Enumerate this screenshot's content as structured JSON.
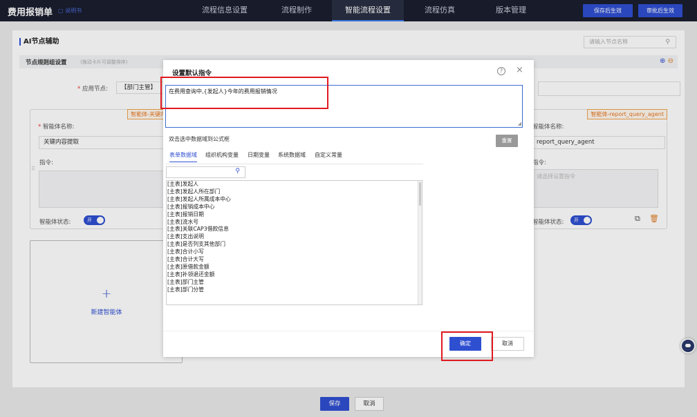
{
  "app": {
    "title": "费用报销单",
    "doc_link": "说明书"
  },
  "nav": {
    "tabs": [
      {
        "label": "流程信息设置"
      },
      {
        "label": "流程制作"
      },
      {
        "label": "智能流程设置"
      },
      {
        "label": "流程仿真"
      },
      {
        "label": "版本管理"
      }
    ],
    "active_index": 2,
    "save_label": "保存后生效",
    "approve_label": "审批后生效"
  },
  "page": {
    "section_title": "AI节点辅助",
    "search_placeholder": "请输入节点名称",
    "group_title": "节点规则组设置",
    "group_hint": "(拖动卡片可调整排序)",
    "apply_node_label": "应用节点:",
    "apply_node_value": "【部门主管】"
  },
  "left_card": {
    "tag": "智能体-关键内容",
    "name_label": "智能体名称:",
    "name_value": "关键内容提取",
    "instruction_label": "指令:",
    "status_label": "智能体状态:",
    "toggle_label": "开"
  },
  "right_card": {
    "tag": "智能体-report_query_agent",
    "name_label": "智能体名称:",
    "name_value": "report_query_agent",
    "instruction_label": "指令:",
    "instruction_placeholder": "请选择设置指令",
    "status_label": "智能体状态:",
    "toggle_label": "开"
  },
  "new_agent": {
    "plus": "+",
    "label": "新建智能体"
  },
  "bottom": {
    "save_label": "保存",
    "cancel_label": "取消"
  },
  "modal": {
    "title": "设置默认指令",
    "instruction_text": "在费用查询中,{发起人}今年的费用报销情况",
    "dbl_click_hint": "双击选中数据域到公式框",
    "reset_label": "重置",
    "sub_tabs": [
      {
        "label": "表单数据域"
      },
      {
        "label": "组织机构变量"
      },
      {
        "label": "日期变量"
      },
      {
        "label": "系统数据域"
      },
      {
        "label": "自定义常量"
      }
    ],
    "field_items": [
      "[主表]发起人",
      "[主表]发起人所在部门",
      "[主表]发起人所属成本中心",
      "[主表]报销成本中心",
      "[主表]报销日期",
      "[主表]流水号",
      "[主表]关联CAP3借款信息",
      "[主表]支出说明",
      "[主表]是否列支其他部门",
      "[主表]合计小写",
      "[主表]合计大写",
      "[主表]原借款金额",
      "[主表]补领退还金额",
      "[主表]部门主管",
      "[主表]部门分管"
    ],
    "ok_label": "确定",
    "cancel_label": "取消"
  },
  "colors": {
    "accent": "#2f4fd1",
    "highlight": "#e0191f",
    "tag_orange": "#e5761e",
    "topbar": "#1a1e2f"
  }
}
